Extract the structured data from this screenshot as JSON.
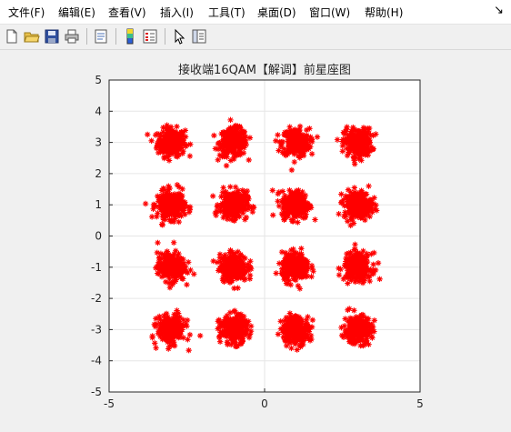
{
  "menu": [
    "文件(F)",
    "编辑(E)",
    "查看(V)",
    "插入(I)",
    "工具(T)",
    "桌面(D)",
    "窗口(W)",
    "帮助(H)"
  ],
  "menu_close_glyph": "↘",
  "toolbar_icons": [
    "new-figure-icon",
    "open-file-icon",
    "save-icon",
    "print-icon",
    "print-preview-icon",
    "colorbar-icon",
    "legend-icon",
    "pointer-icon",
    "property-editor-icon"
  ],
  "colors": {
    "marker": "#ff0000",
    "axes_bg": "#ffffff",
    "figure_bg": "#f0f0f0",
    "grid": "#e6e6e6"
  },
  "chart_data": {
    "type": "scatter",
    "title": "接收端16QAM【解调】前星座图",
    "xlabel": "",
    "ylabel": "",
    "xlim": [
      -5,
      5
    ],
    "ylim": [
      -5,
      5
    ],
    "xticks": [
      -5,
      0,
      5
    ],
    "yticks": [
      -5,
      -4,
      -3,
      -2,
      -1,
      0,
      1,
      2,
      3,
      4,
      5
    ],
    "grid": true,
    "marker": "*",
    "cluster_centers": [
      [
        -3,
        3
      ],
      [
        -1,
        3
      ],
      [
        1,
        3
      ],
      [
        3,
        3
      ],
      [
        -3,
        1
      ],
      [
        -1,
        1
      ],
      [
        1,
        1
      ],
      [
        3,
        1
      ],
      [
        -3,
        -1
      ],
      [
        -1,
        -1
      ],
      [
        1,
        -1
      ],
      [
        3,
        -1
      ],
      [
        -3,
        -3
      ],
      [
        -1,
        -3
      ],
      [
        1,
        -3
      ],
      [
        3,
        -3
      ]
    ],
    "cluster_spread": 0.4
  }
}
